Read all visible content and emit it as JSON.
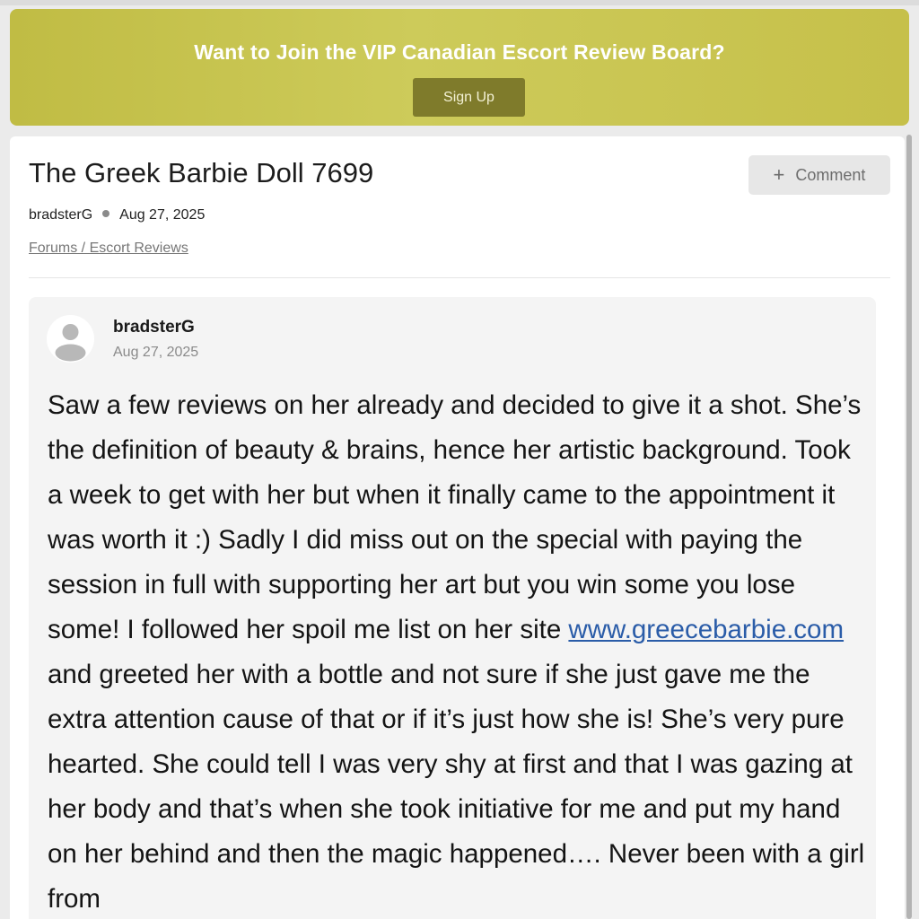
{
  "promo": {
    "title": "Want to Join the VIP Canadian Escort Review Board?",
    "signup_label": "Sign Up"
  },
  "thread": {
    "title": "The Greek Barbie Doll 7699",
    "comment_icon": "plus-icon",
    "comment_label": "Comment",
    "author": "bradsterG",
    "date": "Aug 27, 2025",
    "breadcrumb": "Forums / Escort Reviews"
  },
  "post": {
    "avatar_icon": "user-avatar-icon",
    "author": "bradsterG",
    "date": "Aug 27, 2025",
    "body_before_link": "Saw a few reviews on her already and decided to give it a shot. She’s the definition of beauty & brains, hence her artistic background. Took a week to get with her but when it finally came to the appointment it was worth it :) Sadly I did miss out on the special with paying the session in full with supporting her art but you win some you lose some! I followed her spoil me list on her site ",
    "link_text": "www.greecebarbie.com",
    "body_after_link": " and greeted her with a bottle and not sure if she just gave me the extra attention cause of that or if it’s just how she is! She’s very pure hearted. She could tell I was very shy at first and that I was gazing at her body and that’s when she took initiative for me and put my hand on her behind and then the magic happened…. Never been with a girl from"
  },
  "colors": {
    "promo_bg": "#c9c552",
    "promo_button": "#7f7b2b",
    "link": "#2a5ca8",
    "post_bg": "#f4f4f4"
  }
}
